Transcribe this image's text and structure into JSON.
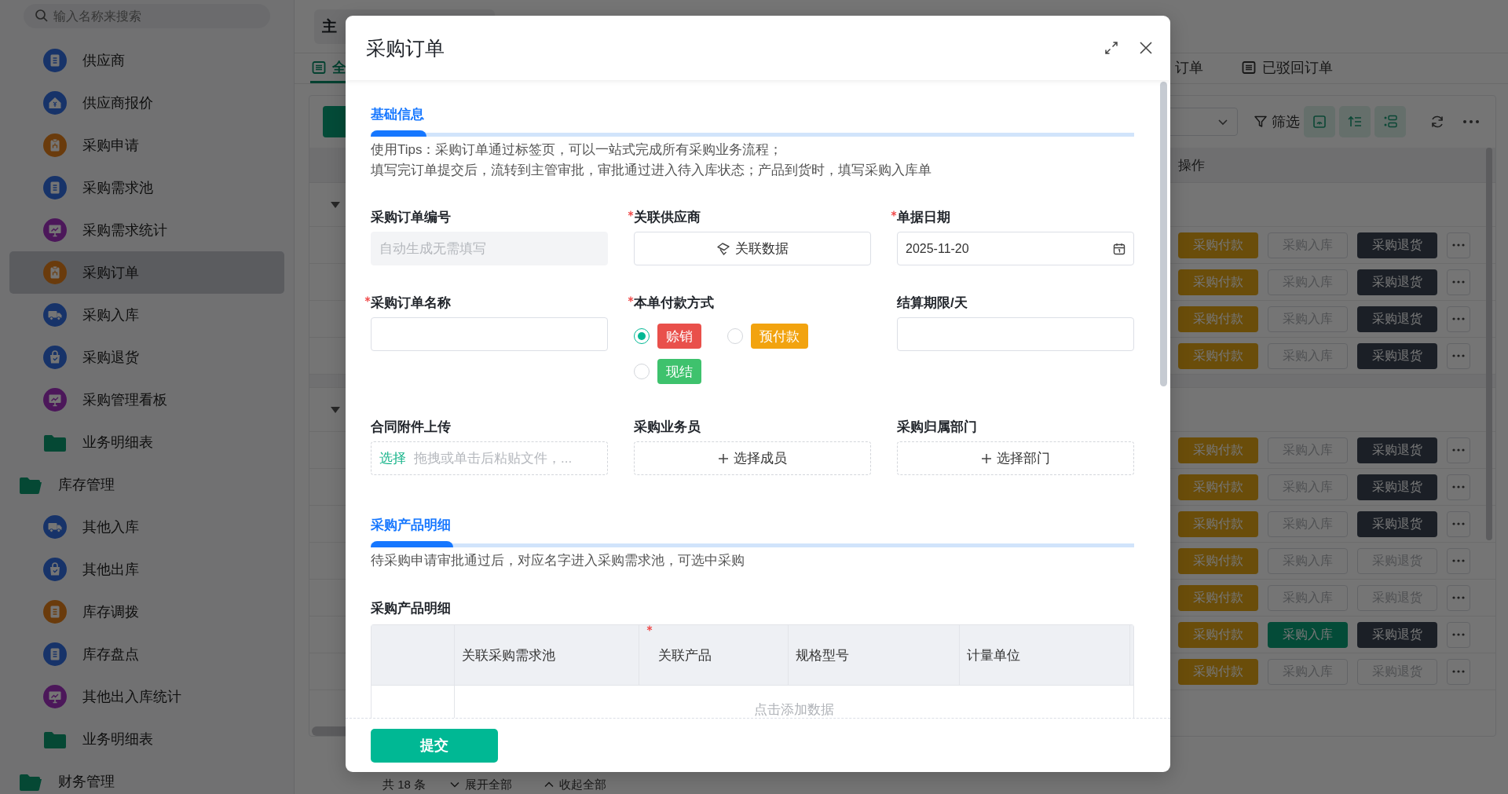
{
  "sidebar": {
    "search": {
      "placeholder": "输入名称来搜索"
    },
    "items": [
      {
        "label": "供应商",
        "kind": "doc",
        "selected": false
      },
      {
        "label": "供应商报价",
        "kind": "house",
        "selected": false
      },
      {
        "label": "采购申请",
        "kind": "org",
        "selected": false
      },
      {
        "label": "采购需求池",
        "kind": "doc",
        "selected": false
      },
      {
        "label": "采购需求统计",
        "kind": "chart",
        "selected": false
      },
      {
        "label": "采购订单",
        "kind": "org",
        "selected": true
      },
      {
        "label": "采购入库",
        "kind": "truck",
        "selected": false
      },
      {
        "label": "采购退货",
        "kind": "bag",
        "selected": false
      },
      {
        "label": "采购管理看板",
        "kind": "chart",
        "selected": false
      },
      {
        "label": "业务明细表",
        "kind": "folder",
        "selected": false
      },
      {
        "label": "库存管理",
        "kind": "group",
        "selected": false,
        "children": [
          {
            "label": "其他入库",
            "kind": "truck",
            "selected": false
          },
          {
            "label": "其他出库",
            "kind": "bag",
            "selected": false
          },
          {
            "label": "库存调拨",
            "kind": "ledger",
            "selected": false
          },
          {
            "label": "库存盘点",
            "kind": "doc",
            "selected": false
          },
          {
            "label": "其他出入库统计",
            "kind": "chart",
            "selected": false
          },
          {
            "label": "业务明细表",
            "kind": "folder",
            "selected": false
          }
        ]
      },
      {
        "label": "财务管理",
        "kind": "group",
        "selected": false
      }
    ]
  },
  "main": {
    "role": "主",
    "tabs": [
      {
        "label": "全",
        "selected": true
      },
      {
        "label": "订单",
        "selected": false
      },
      {
        "label": "已驳回订单",
        "selected": false
      }
    ],
    "toolbar": {
      "filter": "筛选"
    },
    "table": {
      "column": "操作",
      "groups": [
        {
          "expanded": true,
          "rows": [
            {
              "actions": [
                {
                  "label": "采购付款",
                  "kind": "warning"
                },
                {
                  "label": "采购入库",
                  "kind": "plain"
                },
                {
                  "label": "采购退货",
                  "kind": "dark"
                }
              ]
            },
            {
              "actions": [
                {
                  "label": "采购付款",
                  "kind": "warning"
                },
                {
                  "label": "采购入库",
                  "kind": "plain"
                },
                {
                  "label": "采购退货",
                  "kind": "dark"
                }
              ]
            },
            {
              "actions": [
                {
                  "label": "采购付款",
                  "kind": "warning"
                },
                {
                  "label": "采购入库",
                  "kind": "plain"
                },
                {
                  "label": "采购退货",
                  "kind": "dark"
                }
              ]
            },
            {
              "actions": [
                {
                  "label": "采购付款",
                  "kind": "warning"
                },
                {
                  "label": "采购入库",
                  "kind": "plain"
                },
                {
                  "label": "采购退货",
                  "kind": "dark"
                }
              ]
            }
          ]
        },
        {
          "expanded": true,
          "rows": [
            {
              "actions": [
                {
                  "label": "采购付款",
                  "kind": "warning"
                },
                {
                  "label": "采购入库",
                  "kind": "plain"
                },
                {
                  "label": "采购退货",
                  "kind": "dark"
                }
              ]
            },
            {
              "actions": [
                {
                  "label": "采购付款",
                  "kind": "warning"
                },
                {
                  "label": "采购入库",
                  "kind": "plain"
                },
                {
                  "label": "采购退货",
                  "kind": "dark"
                }
              ]
            },
            {
              "actions": [
                {
                  "label": "采购付款",
                  "kind": "warning"
                },
                {
                  "label": "采购入库",
                  "kind": "plain"
                },
                {
                  "label": "采购退货",
                  "kind": "dark"
                }
              ]
            },
            {
              "actions": [
                {
                  "label": "采购付款",
                  "kind": "warning"
                },
                {
                  "label": "采购入库",
                  "kind": "plain"
                },
                {
                  "label": "采购退货",
                  "kind": "plain"
                }
              ]
            },
            {
              "actions": [
                {
                  "label": "采购付款",
                  "kind": "warning"
                },
                {
                  "label": "采购入库",
                  "kind": "plain"
                },
                {
                  "label": "采购退货",
                  "kind": "plain"
                }
              ]
            },
            {
              "actions": [
                {
                  "label": "采购付款",
                  "kind": "warning"
                },
                {
                  "label": "采购入库",
                  "kind": "primary"
                },
                {
                  "label": "采购退货",
                  "kind": "dark"
                }
              ]
            },
            {
              "actions": [
                {
                  "label": "采购付款",
                  "kind": "warning"
                },
                {
                  "label": "采购入库",
                  "kind": "plain"
                },
                {
                  "label": "采购退货",
                  "kind": "plain"
                }
              ]
            }
          ]
        }
      ]
    },
    "footer": {
      "count": "共 18 条",
      "expand_all": "展开全部",
      "collapse_all": "收起全部"
    }
  },
  "modal": {
    "title": "采购订单",
    "sections": [
      {
        "title": "基础信息",
        "notes": [
          "使用Tips：采购订单通过标签页，可以一站式完成所有采购业务流程；",
          "填写完订单提交后，流转到主管审批，审批通过进入待入库状态；产品到货时，填写采购入库单"
        ],
        "fields": [
          {
            "label": "采购订单编号",
            "required": false,
            "kind": "readonly",
            "placeholder": "自动生成无需填写"
          },
          {
            "label": "关联供应商",
            "required": true,
            "kind": "link",
            "button": "关联数据"
          },
          {
            "label": "单据日期",
            "required": true,
            "kind": "date",
            "value": "2025-11-20"
          },
          {
            "label": "采购订单名称",
            "required": true,
            "kind": "text"
          },
          {
            "label": "本单付款方式",
            "required": true,
            "kind": "radio",
            "options": [
              {
                "label": "赊销",
                "color": "#e9504b",
                "selected": true
              },
              {
                "label": "预付款",
                "color": "#f2a30f",
                "selected": false
              },
              {
                "label": "现结",
                "color": "#3ec26d",
                "selected": false
              }
            ]
          },
          {
            "label": "结算期限/天",
            "required": false,
            "kind": "text"
          },
          {
            "label": "合同附件上传",
            "required": false,
            "kind": "upload",
            "action": "选择",
            "hint": "拖拽或单击后粘贴文件，..."
          },
          {
            "label": "采购业务员",
            "required": false,
            "kind": "picker",
            "button": "选择成员"
          },
          {
            "label": "采购归属部门",
            "required": false,
            "kind": "picker",
            "button": "选择部门"
          }
        ]
      },
      {
        "title": "采购产品明细",
        "notes": [
          "待采购申请审批通过后，对应名字进入采购需求池，可选中采购"
        ],
        "table": {
          "label": "采购产品明细",
          "columns": [
            {
              "label": "关联采购需求池",
              "required": false
            },
            {
              "label": "关联产品",
              "required": true
            },
            {
              "label": "规格型号",
              "required": false
            },
            {
              "label": "计量单位",
              "required": false
            }
          ],
          "empty_text": "点击添加数据"
        }
      }
    ],
    "submit": "提交"
  }
}
